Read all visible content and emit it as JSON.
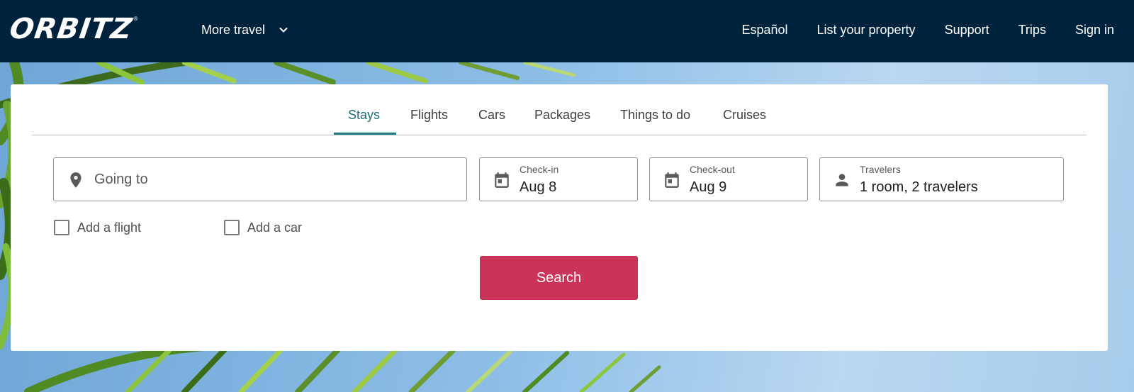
{
  "header": {
    "logo_text": "ORBITZ",
    "logo_reg": "®",
    "more_travel": "More travel",
    "nav": [
      "Español",
      "List your property",
      "Support",
      "Trips",
      "Sign in"
    ]
  },
  "search": {
    "tabs": [
      {
        "label": "Stays",
        "active": true
      },
      {
        "label": "Flights",
        "active": false
      },
      {
        "label": "Cars",
        "active": false
      },
      {
        "label": "Packages",
        "active": false
      },
      {
        "label": "Things to do",
        "active": false
      },
      {
        "label": "Cruises",
        "active": false
      }
    ],
    "destination": {
      "placeholder": "Going to",
      "icon": "map-pin-icon"
    },
    "checkin": {
      "label": "Check-in",
      "value": "Aug 8",
      "icon": "calendar-icon"
    },
    "checkout": {
      "label": "Check-out",
      "value": "Aug 9",
      "icon": "calendar-icon"
    },
    "travelers": {
      "label": "Travelers",
      "value": "1 room, 2 travelers",
      "icon": "person-icon"
    },
    "add_flight": {
      "label": "Add a flight",
      "checked": false
    },
    "add_car": {
      "label": "Add a car",
      "checked": false
    },
    "search_button": "Search"
  },
  "colors": {
    "header_bg": "#00233d",
    "active_tab": "#1d6f76",
    "search_button": "#c93458"
  }
}
